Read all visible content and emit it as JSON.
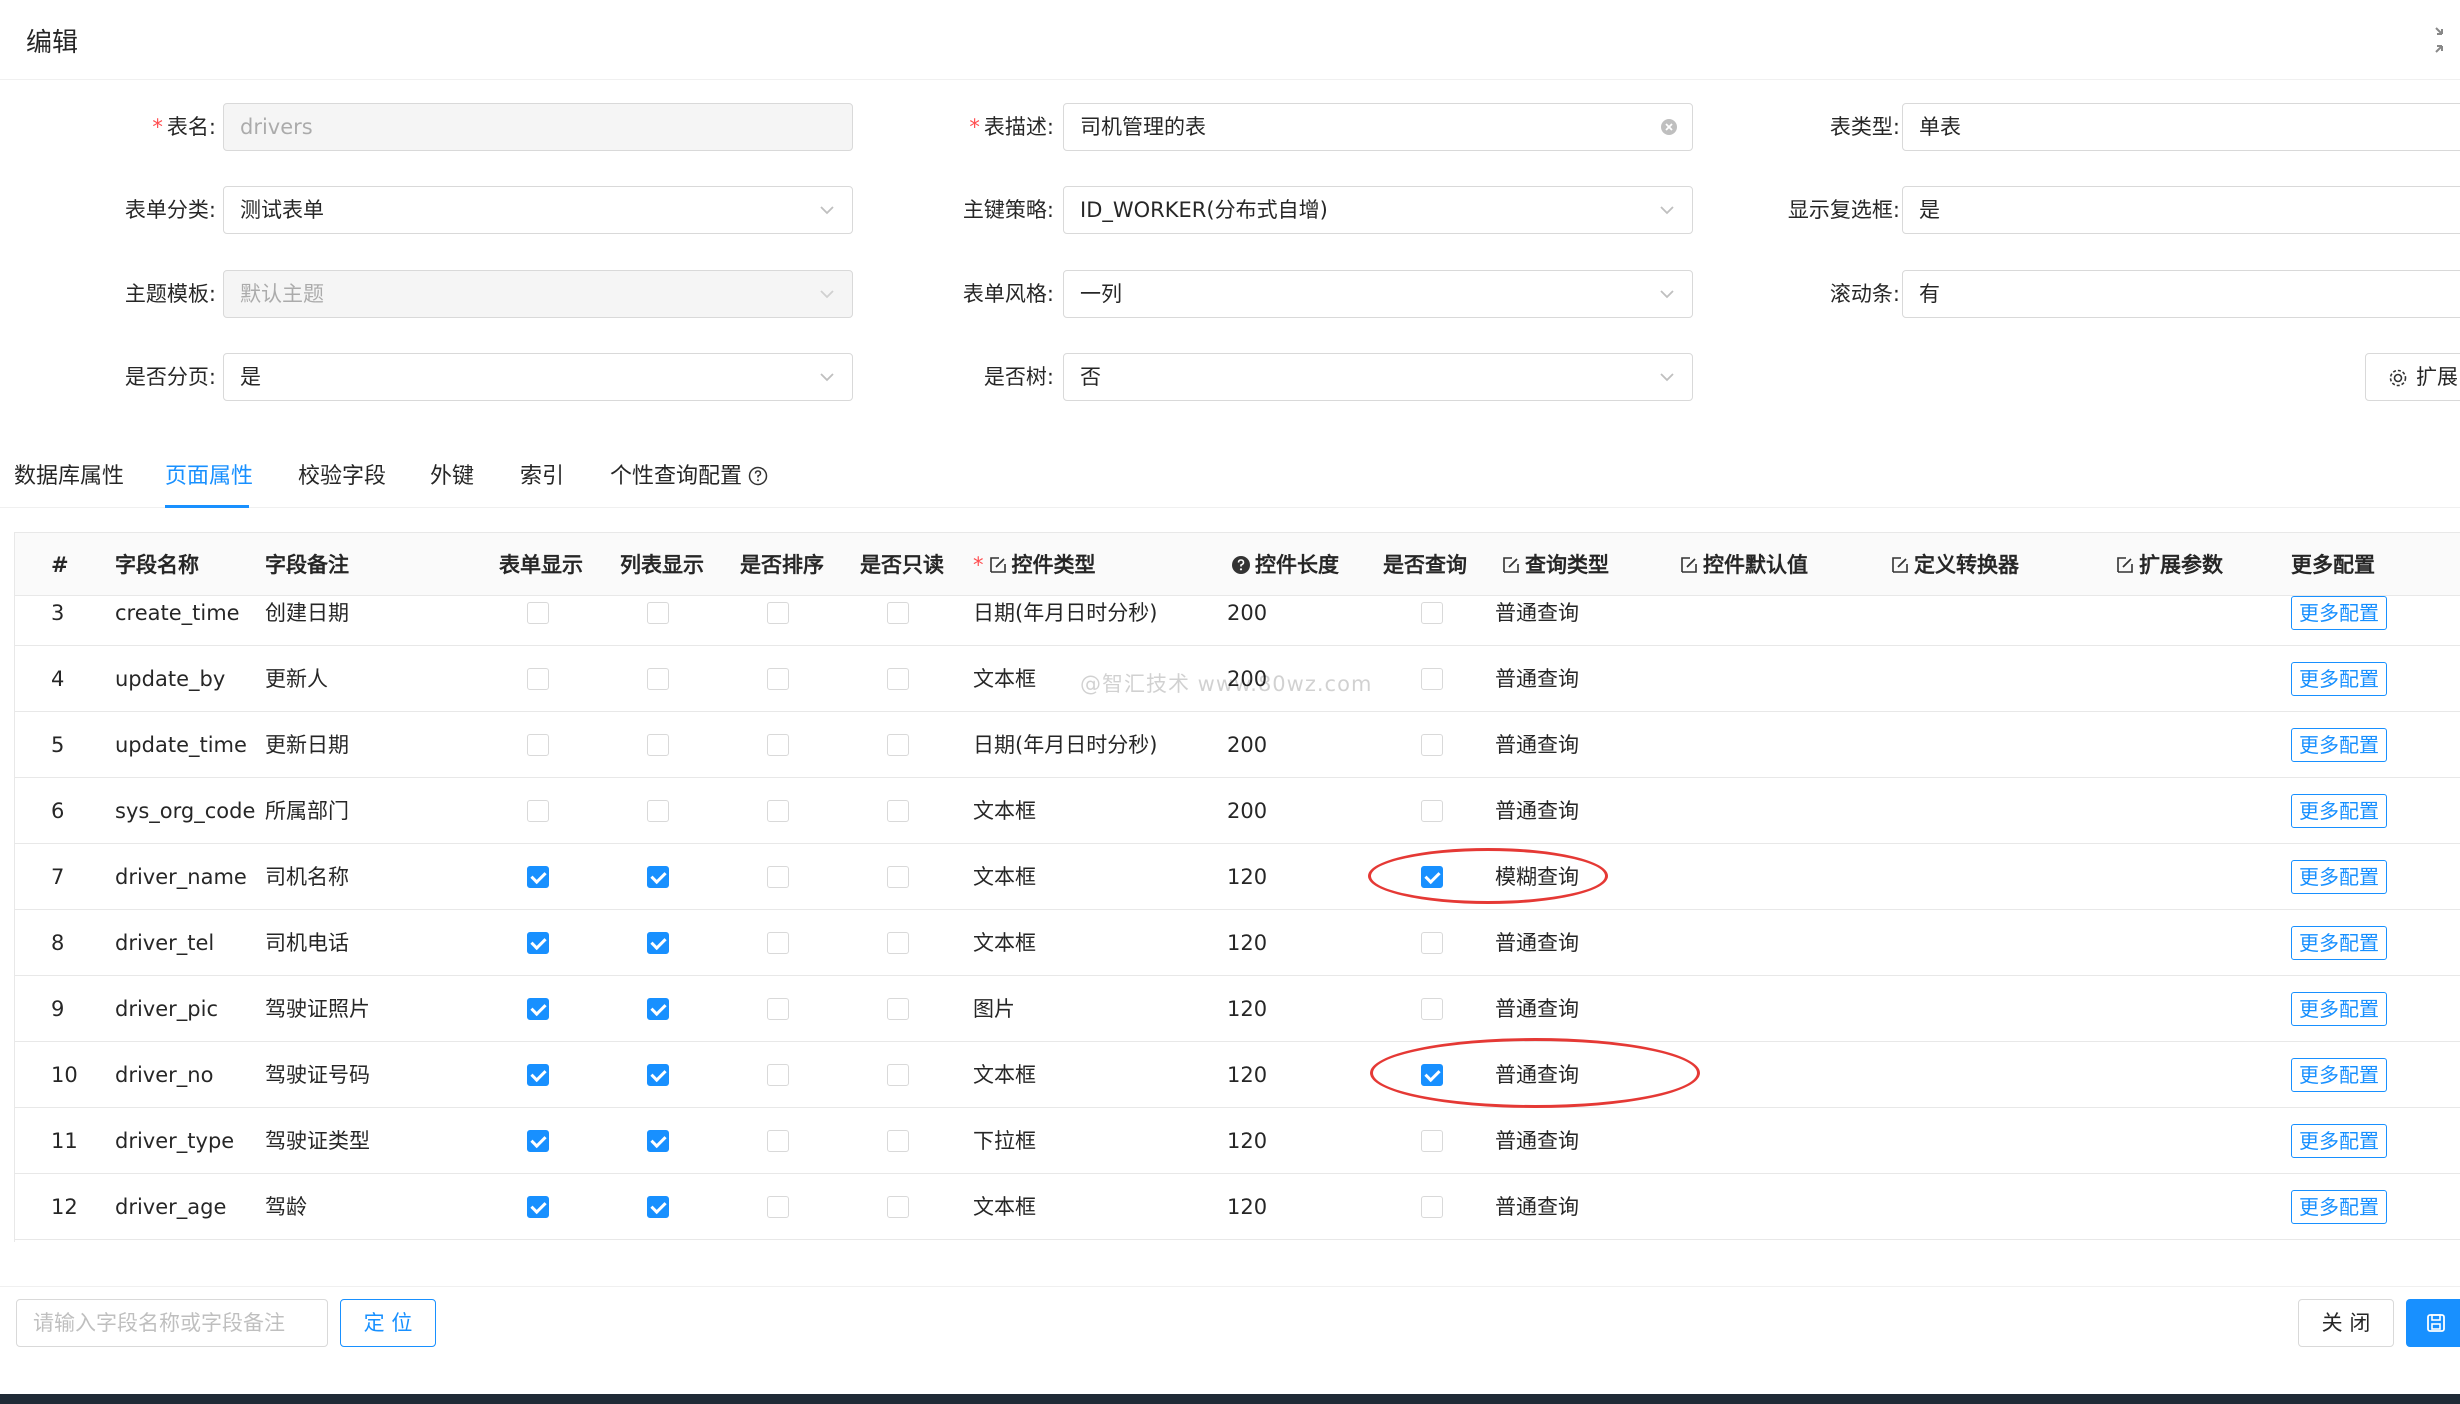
{
  "modal": {
    "title": "编辑"
  },
  "form": {
    "table_name": {
      "label": "表名:",
      "value": "drivers",
      "required": true
    },
    "table_desc": {
      "label": "表描述:",
      "value": "司机管理的表",
      "required": true
    },
    "table_type": {
      "label": "表类型:",
      "value": "单表"
    },
    "form_category": {
      "label": "表单分类:",
      "value": "测试表单"
    },
    "pk_strategy": {
      "label": "主键策略:",
      "value": "ID_WORKER(分布式自增)"
    },
    "show_checkbox": {
      "label": "显示复选框:",
      "value": "是"
    },
    "theme": {
      "label": "主题模板:",
      "value": "默认主题"
    },
    "form_style": {
      "label": "表单风格:",
      "value": "一列"
    },
    "scrollbar": {
      "label": "滚动条:",
      "value": "有"
    },
    "paging": {
      "label": "是否分页:",
      "value": "是"
    },
    "is_tree": {
      "label": "是否树:",
      "value": "否"
    },
    "extend_button": "扩展"
  },
  "tabs": [
    {
      "label": "数据库属性",
      "active": false
    },
    {
      "label": "页面属性",
      "active": true
    },
    {
      "label": "校验字段",
      "active": false
    },
    {
      "label": "外键",
      "active": false
    },
    {
      "label": "索引",
      "active": false
    },
    {
      "label": "个性查询配置",
      "active": false
    }
  ],
  "table": {
    "headers": {
      "index": "#",
      "field_name": "字段名称",
      "field_remark": "字段备注",
      "form_show": "表单显示",
      "list_show": "列表显示",
      "is_sort": "是否排序",
      "is_readonly": "是否只读",
      "control_type": "控件类型",
      "control_length": "控件长度",
      "is_query": "是否查询",
      "query_type": "查询类型",
      "control_default": "控件默认值",
      "converter": "定义转换器",
      "ext_params": "扩展参数",
      "more_config": "更多配置"
    },
    "rows": [
      {
        "index": "3",
        "name": "create_time",
        "remark": "创建日期",
        "form_show": false,
        "list_show": false,
        "sort": false,
        "readonly": false,
        "control_type": "日期(年月日时分秒)",
        "length": "200",
        "query": false,
        "query_type": "普通查询",
        "more": "更多配置"
      },
      {
        "index": "4",
        "name": "update_by",
        "remark": "更新人",
        "form_show": false,
        "list_show": false,
        "sort": false,
        "readonly": false,
        "control_type": "文本框",
        "length": "200",
        "query": false,
        "query_type": "普通查询",
        "more": "更多配置"
      },
      {
        "index": "5",
        "name": "update_time",
        "remark": "更新日期",
        "form_show": false,
        "list_show": false,
        "sort": false,
        "readonly": false,
        "control_type": "日期(年月日时分秒)",
        "length": "200",
        "query": false,
        "query_type": "普通查询",
        "more": "更多配置"
      },
      {
        "index": "6",
        "name": "sys_org_code",
        "remark": "所属部门",
        "form_show": false,
        "list_show": false,
        "sort": false,
        "readonly": false,
        "control_type": "文本框",
        "length": "200",
        "query": false,
        "query_type": "普通查询",
        "more": "更多配置"
      },
      {
        "index": "7",
        "name": "driver_name",
        "remark": "司机名称",
        "form_show": true,
        "list_show": true,
        "sort": false,
        "readonly": false,
        "control_type": "文本框",
        "length": "120",
        "query": true,
        "query_type": "模糊查询",
        "more": "更多配置"
      },
      {
        "index": "8",
        "name": "driver_tel",
        "remark": "司机电话",
        "form_show": true,
        "list_show": true,
        "sort": false,
        "readonly": false,
        "control_type": "文本框",
        "length": "120",
        "query": false,
        "query_type": "普通查询",
        "more": "更多配置"
      },
      {
        "index": "9",
        "name": "driver_pic",
        "remark": "驾驶证照片",
        "form_show": true,
        "list_show": true,
        "sort": false,
        "readonly": false,
        "control_type": "图片",
        "length": "120",
        "query": false,
        "query_type": "普通查询",
        "more": "更多配置"
      },
      {
        "index": "10",
        "name": "driver_no",
        "remark": "驾驶证号码",
        "form_show": true,
        "list_show": true,
        "sort": false,
        "readonly": false,
        "control_type": "文本框",
        "length": "120",
        "query": true,
        "query_type": "普通查询",
        "more": "更多配置"
      },
      {
        "index": "11",
        "name": "driver_type",
        "remark": "驾驶证类型",
        "form_show": true,
        "list_show": true,
        "sort": false,
        "readonly": false,
        "control_type": "下拉框",
        "length": "120",
        "query": false,
        "query_type": "普通查询",
        "more": "更多配置"
      },
      {
        "index": "12",
        "name": "driver_age",
        "remark": "驾龄",
        "form_show": true,
        "list_show": true,
        "sort": false,
        "readonly": false,
        "control_type": "文本框",
        "length": "120",
        "query": false,
        "query_type": "普通查询",
        "more": "更多配置"
      }
    ]
  },
  "watermark": "@智汇技术 www.80wz.com",
  "footer": {
    "search_placeholder": "请输入字段名称或字段备注",
    "locate_label": "定 位",
    "close_label": "关 闭"
  },
  "colors": {
    "primary": "#1890ff",
    "required": "#ff4d4f",
    "annotation": "#e53935"
  }
}
